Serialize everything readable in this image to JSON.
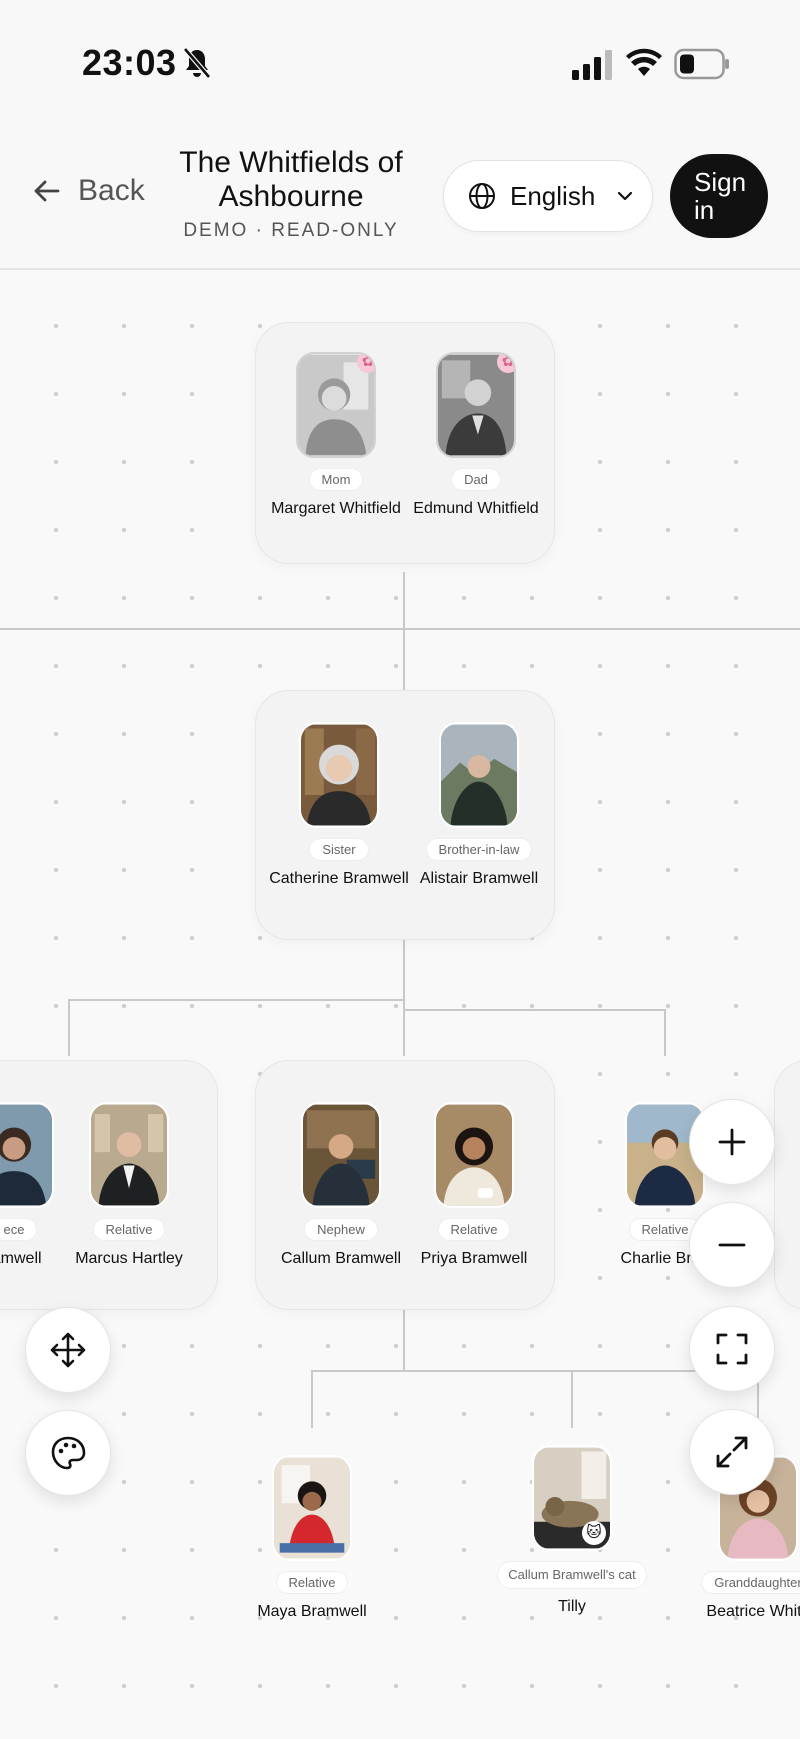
{
  "status_bar": {
    "time": "23:03"
  },
  "header": {
    "back_label": "Back",
    "title": "The Whitfields of Ashbourne",
    "subtitle": "DEMO · READ-ONLY",
    "language": "English",
    "sign_in": "Sign in"
  },
  "tree": {
    "grandparents": [
      {
        "relation": "Mom",
        "name": "Margaret Whitfield",
        "badge": "✿"
      },
      {
        "relation": "Dad",
        "name": "Edmund Whitfield",
        "badge": "✿"
      }
    ],
    "parents": [
      {
        "relation": "Sister",
        "name": "Catherine Bramwell"
      },
      {
        "relation": "Brother-in-law",
        "name": "Alistair Bramwell"
      }
    ],
    "gen3_left": [
      {
        "relation": "ece",
        "name": "ramwell"
      },
      {
        "relation": "Relative",
        "name": "Marcus Hartley"
      }
    ],
    "gen3_center": [
      {
        "relation": "Nephew",
        "name": "Callum Bramwell"
      },
      {
        "relation": "Relative",
        "name": "Priya Bramwell"
      }
    ],
    "gen3_right": {
      "relation": "Relative",
      "name": "Charlie Bran"
    },
    "gen4": [
      {
        "relation": "Relative",
        "name": "Maya Bramwell"
      },
      {
        "relation": "Callum Bramwell's cat",
        "name": "Tilly",
        "badge": "🐱"
      },
      {
        "relation": "Granddaughter",
        "name": "Beatrice Whitfi"
      }
    ]
  },
  "icons": {
    "back": "arrow-left-icon",
    "language": "globe-icon",
    "zoom_in": "plus-icon",
    "zoom_out": "minus-icon",
    "fit": "fit-screen-icon",
    "fullscreen": "expand-icon",
    "pan": "move-icon",
    "theme": "palette-icon"
  }
}
